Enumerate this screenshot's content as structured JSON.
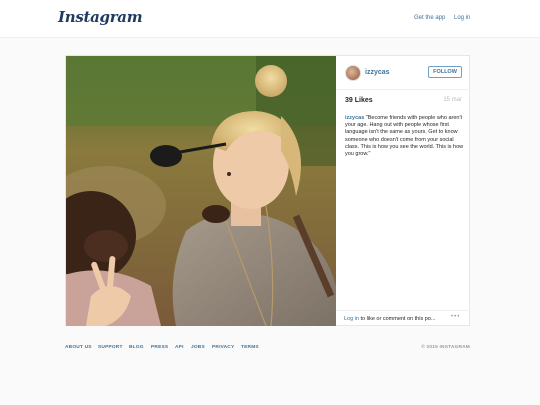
{
  "header": {
    "logo": "Instagram",
    "get_app": "Get the app",
    "login": "Log in"
  },
  "post": {
    "username": "izzycas",
    "follow_label": "FOLLOW",
    "likes": "39 Likes",
    "time": "15 mar",
    "caption_user": "izzycas",
    "caption_text": " \"Become friends with people who aren't your age. Hang out with people whose first language isn't the same as yours. Get to know someone who doesn't come from your social class. This is how you see the world. This is how you grow.\"",
    "login_link": "Log in",
    "login_text": " to like or comment on this po...",
    "more": "•••"
  },
  "footer": {
    "links": [
      "ABOUT US",
      "SUPPORT",
      "BLOG",
      "PRESS",
      "API",
      "JOBS",
      "PRIVACY",
      "TERMS"
    ],
    "copyright": "© 2015 INSTAGRAM"
  },
  "colors": {
    "link": "#3f729b",
    "background": "#fafafa"
  }
}
